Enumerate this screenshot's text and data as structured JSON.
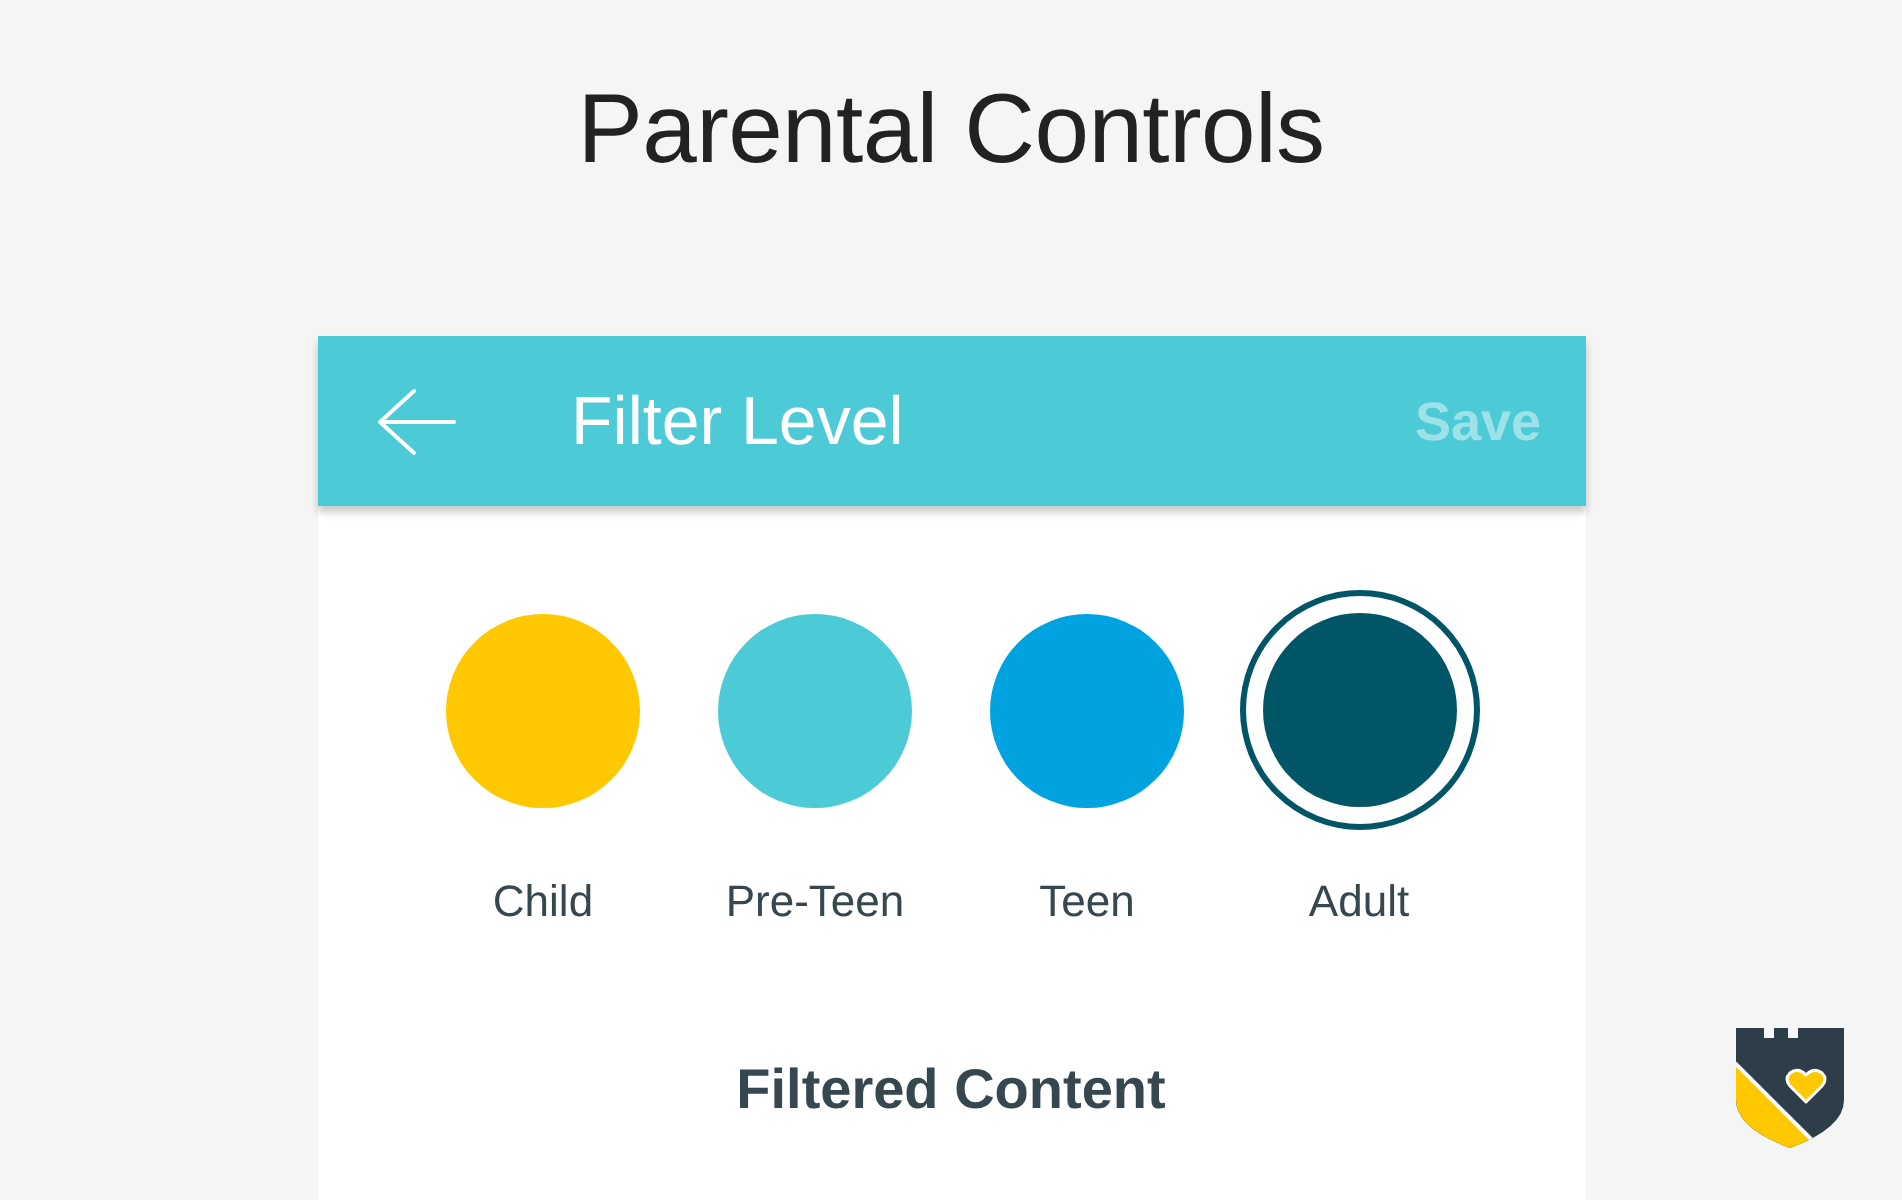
{
  "title": "Parental Controls",
  "screen": {
    "app_bar": {
      "title": "Filter Level",
      "save": {
        "label": "Save",
        "disabled": true
      }
    },
    "filter_levels": [
      {
        "label": "Child",
        "color": "#ffc800",
        "selected": false
      },
      {
        "label": "Pre-Teen",
        "color": "#4ccbd6",
        "selected": false
      },
      {
        "label": "Teen",
        "color": "#00a3e0",
        "selected": false
      },
      {
        "label": "Adult",
        "color": "#005566",
        "selected": true
      }
    ],
    "section_title": "Filtered Content"
  }
}
